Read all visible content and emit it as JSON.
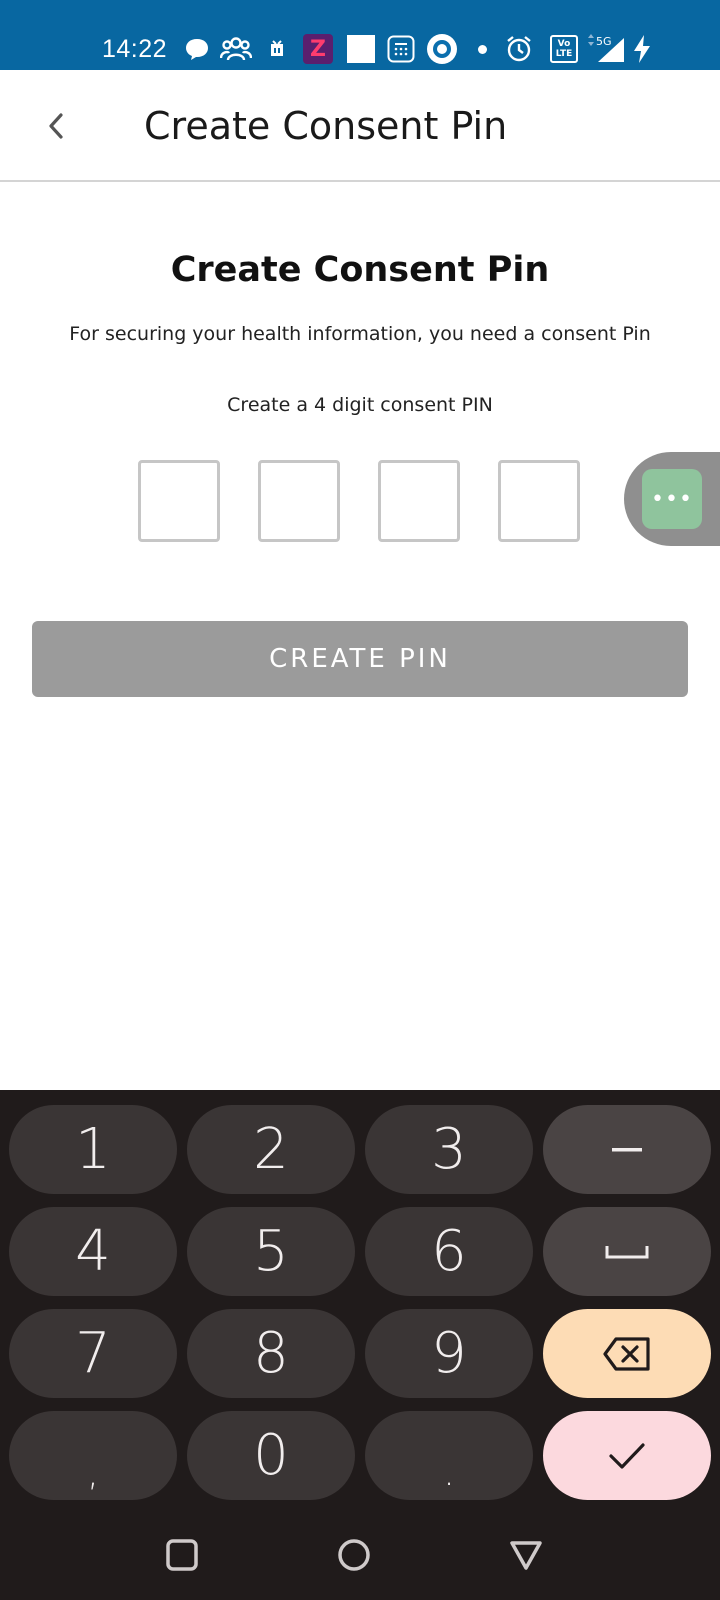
{
  "status_bar": {
    "time": "14:22",
    "icons": [
      "chat-bubble-icon",
      "group-icon",
      "sim-icon",
      "zee-app-icon",
      "white-square-icon",
      "calculator-icon",
      "circle-app-icon",
      "dot-icon",
      "alarm-icon",
      "volte-icon",
      "5g-signal-icon",
      "charging-icon"
    ],
    "zee_label": "Z",
    "volte_label": "Vo LTE",
    "network_label": "5G"
  },
  "app_bar": {
    "title": "Create Consent Pin"
  },
  "main": {
    "heading": "Create Consent Pin",
    "subtitle": "For securing your health information, you need a consent Pin",
    "pin_label": "Create a 4 digit consent PIN",
    "pin_digits": [
      "",
      "",
      "",
      ""
    ],
    "create_button": "CREATE PIN",
    "floating_menu": "•••"
  },
  "keyboard": {
    "rows": [
      [
        "1",
        "2",
        "3",
        "−"
      ],
      [
        "4",
        "5",
        "6",
        "␣"
      ],
      [
        "7",
        "8",
        "9",
        "⌫"
      ],
      [
        ",",
        "0",
        ".",
        "✓"
      ]
    ]
  },
  "colors": {
    "status_bar": "#0867a1",
    "button_disabled": "#9b9b9b",
    "keyboard_bg": "#201b1b",
    "key_bg": "#3a3535",
    "delete_key": "#fddcb5",
    "enter_key": "#fcd9de",
    "floating_btn": "#8fc49d"
  },
  "nav_bar": {
    "icons": [
      "recents-square-icon",
      "home-circle-icon",
      "back-triangle-icon"
    ]
  }
}
